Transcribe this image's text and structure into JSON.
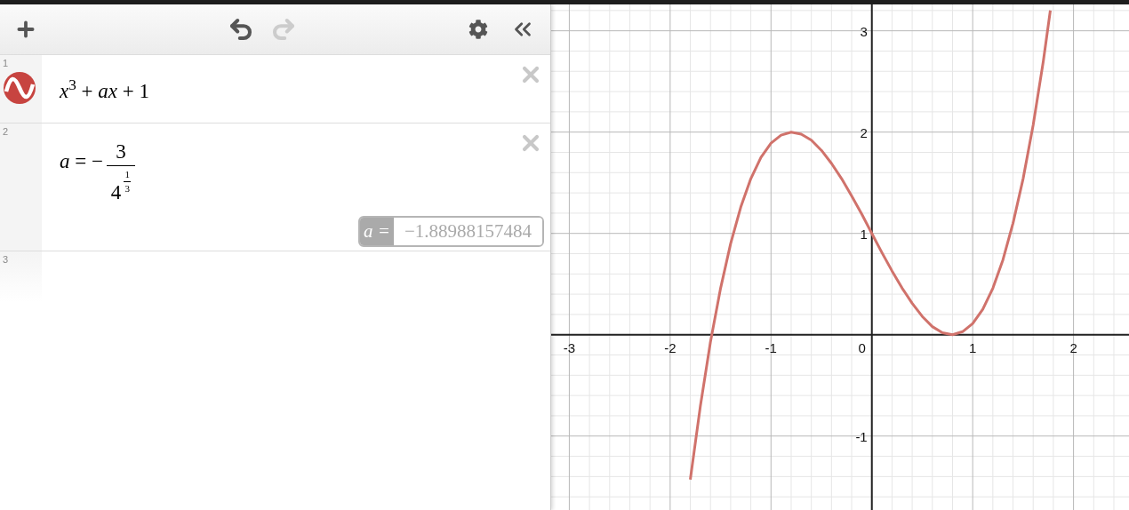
{
  "toolbar": {
    "undo_disabled": false,
    "redo_disabled": true
  },
  "expressions": [
    {
      "number": "1",
      "kind": "formula",
      "color": "#c74440",
      "latex": "*x*$^{3}$ + *ax* + 1"
    },
    {
      "number": "2",
      "kind": "fraction",
      "lhs": "*a* = −",
      "numerator": "3",
      "base": "4",
      "exp_numerator": "1",
      "exp_denominator": "3",
      "evaluation": {
        "label": "a =",
        "value": "−1.88988157484"
      }
    },
    {
      "number": "3",
      "kind": "empty"
    }
  ],
  "graph": {
    "origin_label": "0",
    "chart_data": {
      "type": "line",
      "grid": true,
      "xlim": [
        -3.18,
        2.55
      ],
      "ylim": [
        -1.73,
        3.26
      ],
      "xticks": [
        -3,
        -2,
        -1,
        1,
        2
      ],
      "yticks": [
        -1,
        1,
        2,
        3
      ],
      "x": [
        -1.8,
        -1.7,
        -1.6,
        -1.5,
        -1.4,
        -1.3,
        -1.2,
        -1.1,
        -1.0,
        -0.9,
        -0.8,
        -0.7,
        -0.6,
        -0.5,
        -0.4,
        -0.3,
        -0.2,
        -0.1,
        0,
        0.1,
        0.2,
        0.3,
        0.4,
        0.5,
        0.6,
        0.7,
        0.8,
        0.9,
        1.0,
        1.1,
        1.2,
        1.3,
        1.4,
        1.5,
        1.6,
        1.7,
        1.77
      ],
      "series": [
        {
          "color": "#d0726b",
          "values": [
            -1.43,
            -0.7,
            -0.07,
            0.46,
            0.9,
            1.26,
            1.54,
            1.75,
            1.89,
            1.97,
            2.0,
            1.98,
            1.92,
            1.82,
            1.69,
            1.54,
            1.37,
            1.19,
            1,
            0.81,
            0.63,
            0.46,
            0.31,
            0.18,
            0.08,
            0.02,
            0.0,
            0.03,
            0.11,
            0.25,
            0.46,
            0.74,
            1.1,
            1.54,
            2.07,
            2.7,
            3.2
          ]
        }
      ]
    }
  }
}
